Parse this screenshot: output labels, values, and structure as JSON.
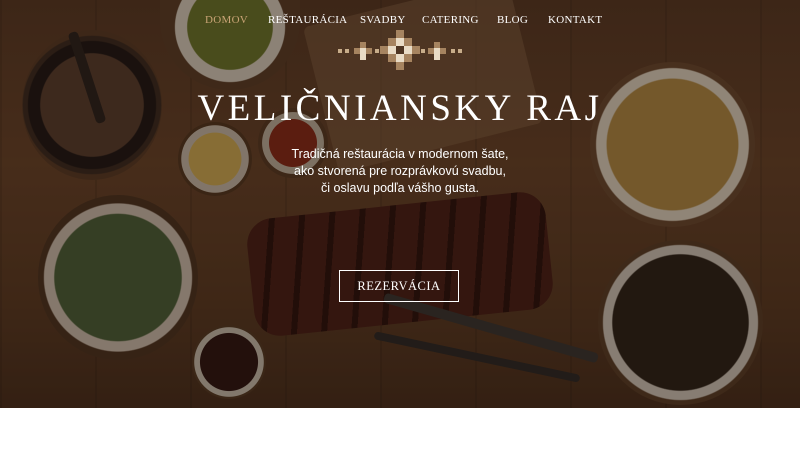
{
  "nav": {
    "items": [
      {
        "label": "DOMOV",
        "active": true
      },
      {
        "label": "REŠTAURÁCIA",
        "active": false
      },
      {
        "label": "SVADBY",
        "active": false
      },
      {
        "label": "CATERING",
        "active": false
      },
      {
        "label": "BLOG",
        "active": false
      },
      {
        "label": "KONTAKT",
        "active": false
      }
    ]
  },
  "hero": {
    "title": "VELIČNIANSKY RAJ",
    "tagline": [
      "Tradičná reštaurácia v modernom šate,",
      "ako stvorená pre rozprávkovú svadbu,",
      "či oslavu podľa vášho gusta."
    ],
    "cta_label": "REZERVÁCIA",
    "background": "food-table-photo"
  },
  "colors": {
    "accent": "#c9a476",
    "text": "#ffffff",
    "ornament_dark": "#a68460",
    "ornament_light": "#e9dcc6"
  },
  "icons": {
    "logo": "folk-ornament-icon"
  }
}
